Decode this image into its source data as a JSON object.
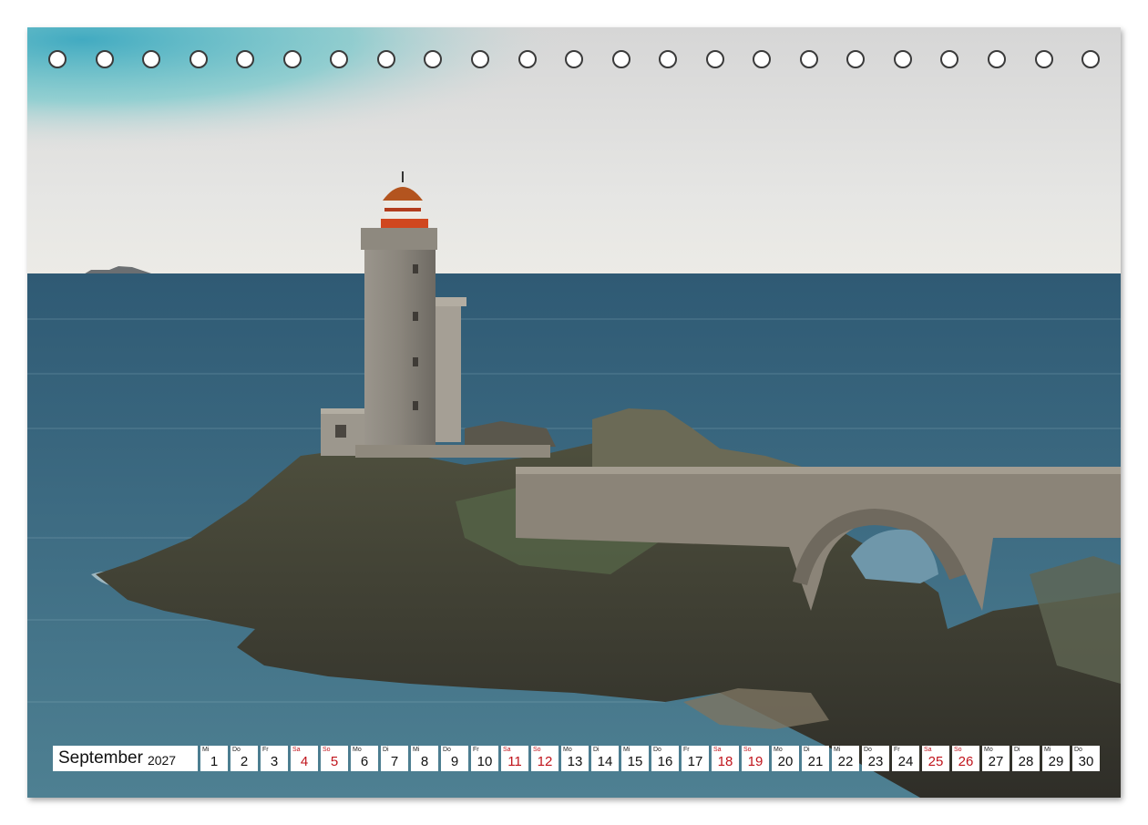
{
  "calendar": {
    "month": "September",
    "year": "2027",
    "weekend_color": "#c0141c",
    "days": [
      {
        "wd": "Mi",
        "d": "1",
        "we": false
      },
      {
        "wd": "Do",
        "d": "2",
        "we": false
      },
      {
        "wd": "Fr",
        "d": "3",
        "we": false
      },
      {
        "wd": "Sa",
        "d": "4",
        "we": true
      },
      {
        "wd": "So",
        "d": "5",
        "we": true
      },
      {
        "wd": "Mo",
        "d": "6",
        "we": false
      },
      {
        "wd": "Di",
        "d": "7",
        "we": false
      },
      {
        "wd": "Mi",
        "d": "8",
        "we": false
      },
      {
        "wd": "Do",
        "d": "9",
        "we": false
      },
      {
        "wd": "Fr",
        "d": "10",
        "we": false
      },
      {
        "wd": "Sa",
        "d": "11",
        "we": true
      },
      {
        "wd": "So",
        "d": "12",
        "we": true
      },
      {
        "wd": "Mo",
        "d": "13",
        "we": false
      },
      {
        "wd": "Di",
        "d": "14",
        "we": false
      },
      {
        "wd": "Mi",
        "d": "15",
        "we": false
      },
      {
        "wd": "Do",
        "d": "16",
        "we": false
      },
      {
        "wd": "Fr",
        "d": "17",
        "we": false
      },
      {
        "wd": "Sa",
        "d": "18",
        "we": true
      },
      {
        "wd": "So",
        "d": "19",
        "we": true
      },
      {
        "wd": "Mo",
        "d": "20",
        "we": false
      },
      {
        "wd": "Di",
        "d": "21",
        "we": false
      },
      {
        "wd": "Mi",
        "d": "22",
        "we": false
      },
      {
        "wd": "Do",
        "d": "23",
        "we": false
      },
      {
        "wd": "Fr",
        "d": "24",
        "we": false
      },
      {
        "wd": "Sa",
        "d": "25",
        "we": true
      },
      {
        "wd": "So",
        "d": "26",
        "we": true
      },
      {
        "wd": "Mo",
        "d": "27",
        "we": false
      },
      {
        "wd": "Di",
        "d": "28",
        "we": false
      },
      {
        "wd": "Mi",
        "d": "29",
        "we": false
      },
      {
        "wd": "Do",
        "d": "30",
        "we": false
      }
    ]
  },
  "binding": {
    "hole_count": 23
  },
  "photo": {
    "icon": "lighthouse-photo",
    "colors": {
      "sky": "#e3e3e3",
      "sea": "#3e6478",
      "rock": "#4a4a40",
      "stone": "#8a8478"
    }
  }
}
